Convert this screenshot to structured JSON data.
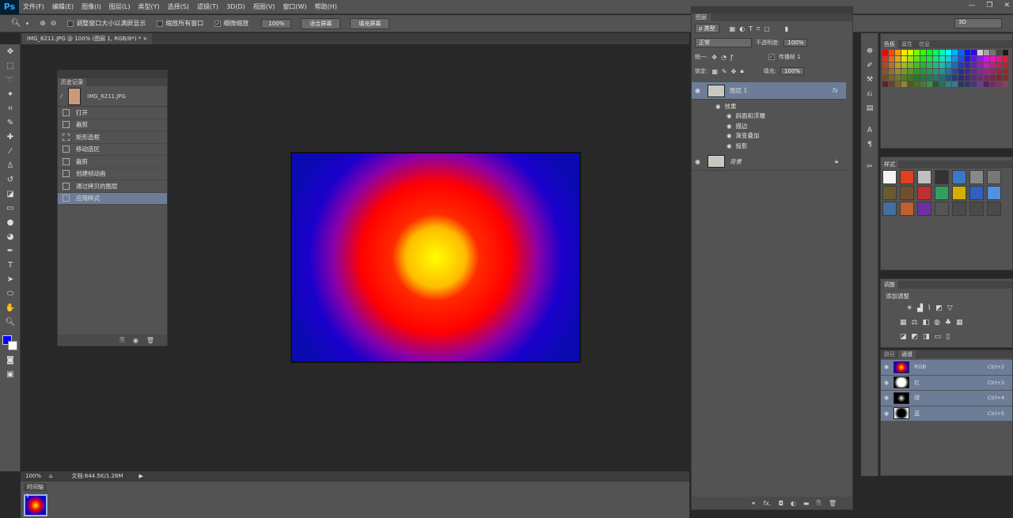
{
  "menu": [
    "文件(F)",
    "编辑(E)",
    "图像(I)",
    "图层(L)",
    "类型(Y)",
    "选择(S)",
    "滤镜(T)",
    "3D(D)",
    "视图(V)",
    "窗口(W)",
    "帮助(H)"
  ],
  "app_logo": "Ps",
  "options": {
    "resize_window": "调整窗口大小以满屏显示",
    "zoom_all": "缩放所有窗口",
    "scrubby_zoom": "细微缩放",
    "zoom_value": "100%",
    "fit_screen": "适合屏幕",
    "fill_screen": "填充屏幕",
    "workspace": "3D"
  },
  "document_tab": "IMG_6211.JPG @ 100% (图层 1, RGB/8*) *",
  "history": {
    "title": "历史记录",
    "snapshot": "IMG_6211.JPG",
    "steps": [
      "打开",
      "裁剪",
      "矩形选框",
      "移动选区",
      "裁剪",
      "创建帧动画",
      "通过拷贝的图层",
      "应用样式"
    ],
    "selected_index": 7
  },
  "status": {
    "zoom": "100%",
    "doc_info": "文档:644.5K/1.26M"
  },
  "timeline": {
    "title": "时间轴",
    "frame_number": "1"
  },
  "layers": {
    "title": "图层",
    "filter_kind": "ρ 类型",
    "blend_mode": "正常",
    "opacity_label": "不透明度:",
    "opacity": "100%",
    "unify_label": "统一:",
    "propagate_label": "传播帧 1",
    "lock_label": "锁定:",
    "fill_label": "填充:",
    "fill": "100%",
    "layer1_name": "图层 1",
    "effects_label": "效果",
    "effects": [
      "斜面和浮雕",
      "描边",
      "渐变叠加",
      "投影"
    ],
    "bg_name": "背景"
  },
  "swatches_tabs": [
    "色板",
    "属性",
    "信息"
  ],
  "styles_title": "样式",
  "adjust": {
    "title": "调整",
    "add_label": "添加调整"
  },
  "channels": {
    "tabs": [
      "路径",
      "通道"
    ],
    "rows": [
      {
        "name": "RGB",
        "key": "Ctrl+2"
      },
      {
        "name": "红",
        "key": "Ctrl+3"
      },
      {
        "name": "绿",
        "key": "Ctrl+4"
      },
      {
        "name": "蓝",
        "key": "Ctrl+5"
      }
    ]
  },
  "colors": {
    "foreground": "#0000ff",
    "background": "#ffffff",
    "selection": "#6d7d98"
  }
}
